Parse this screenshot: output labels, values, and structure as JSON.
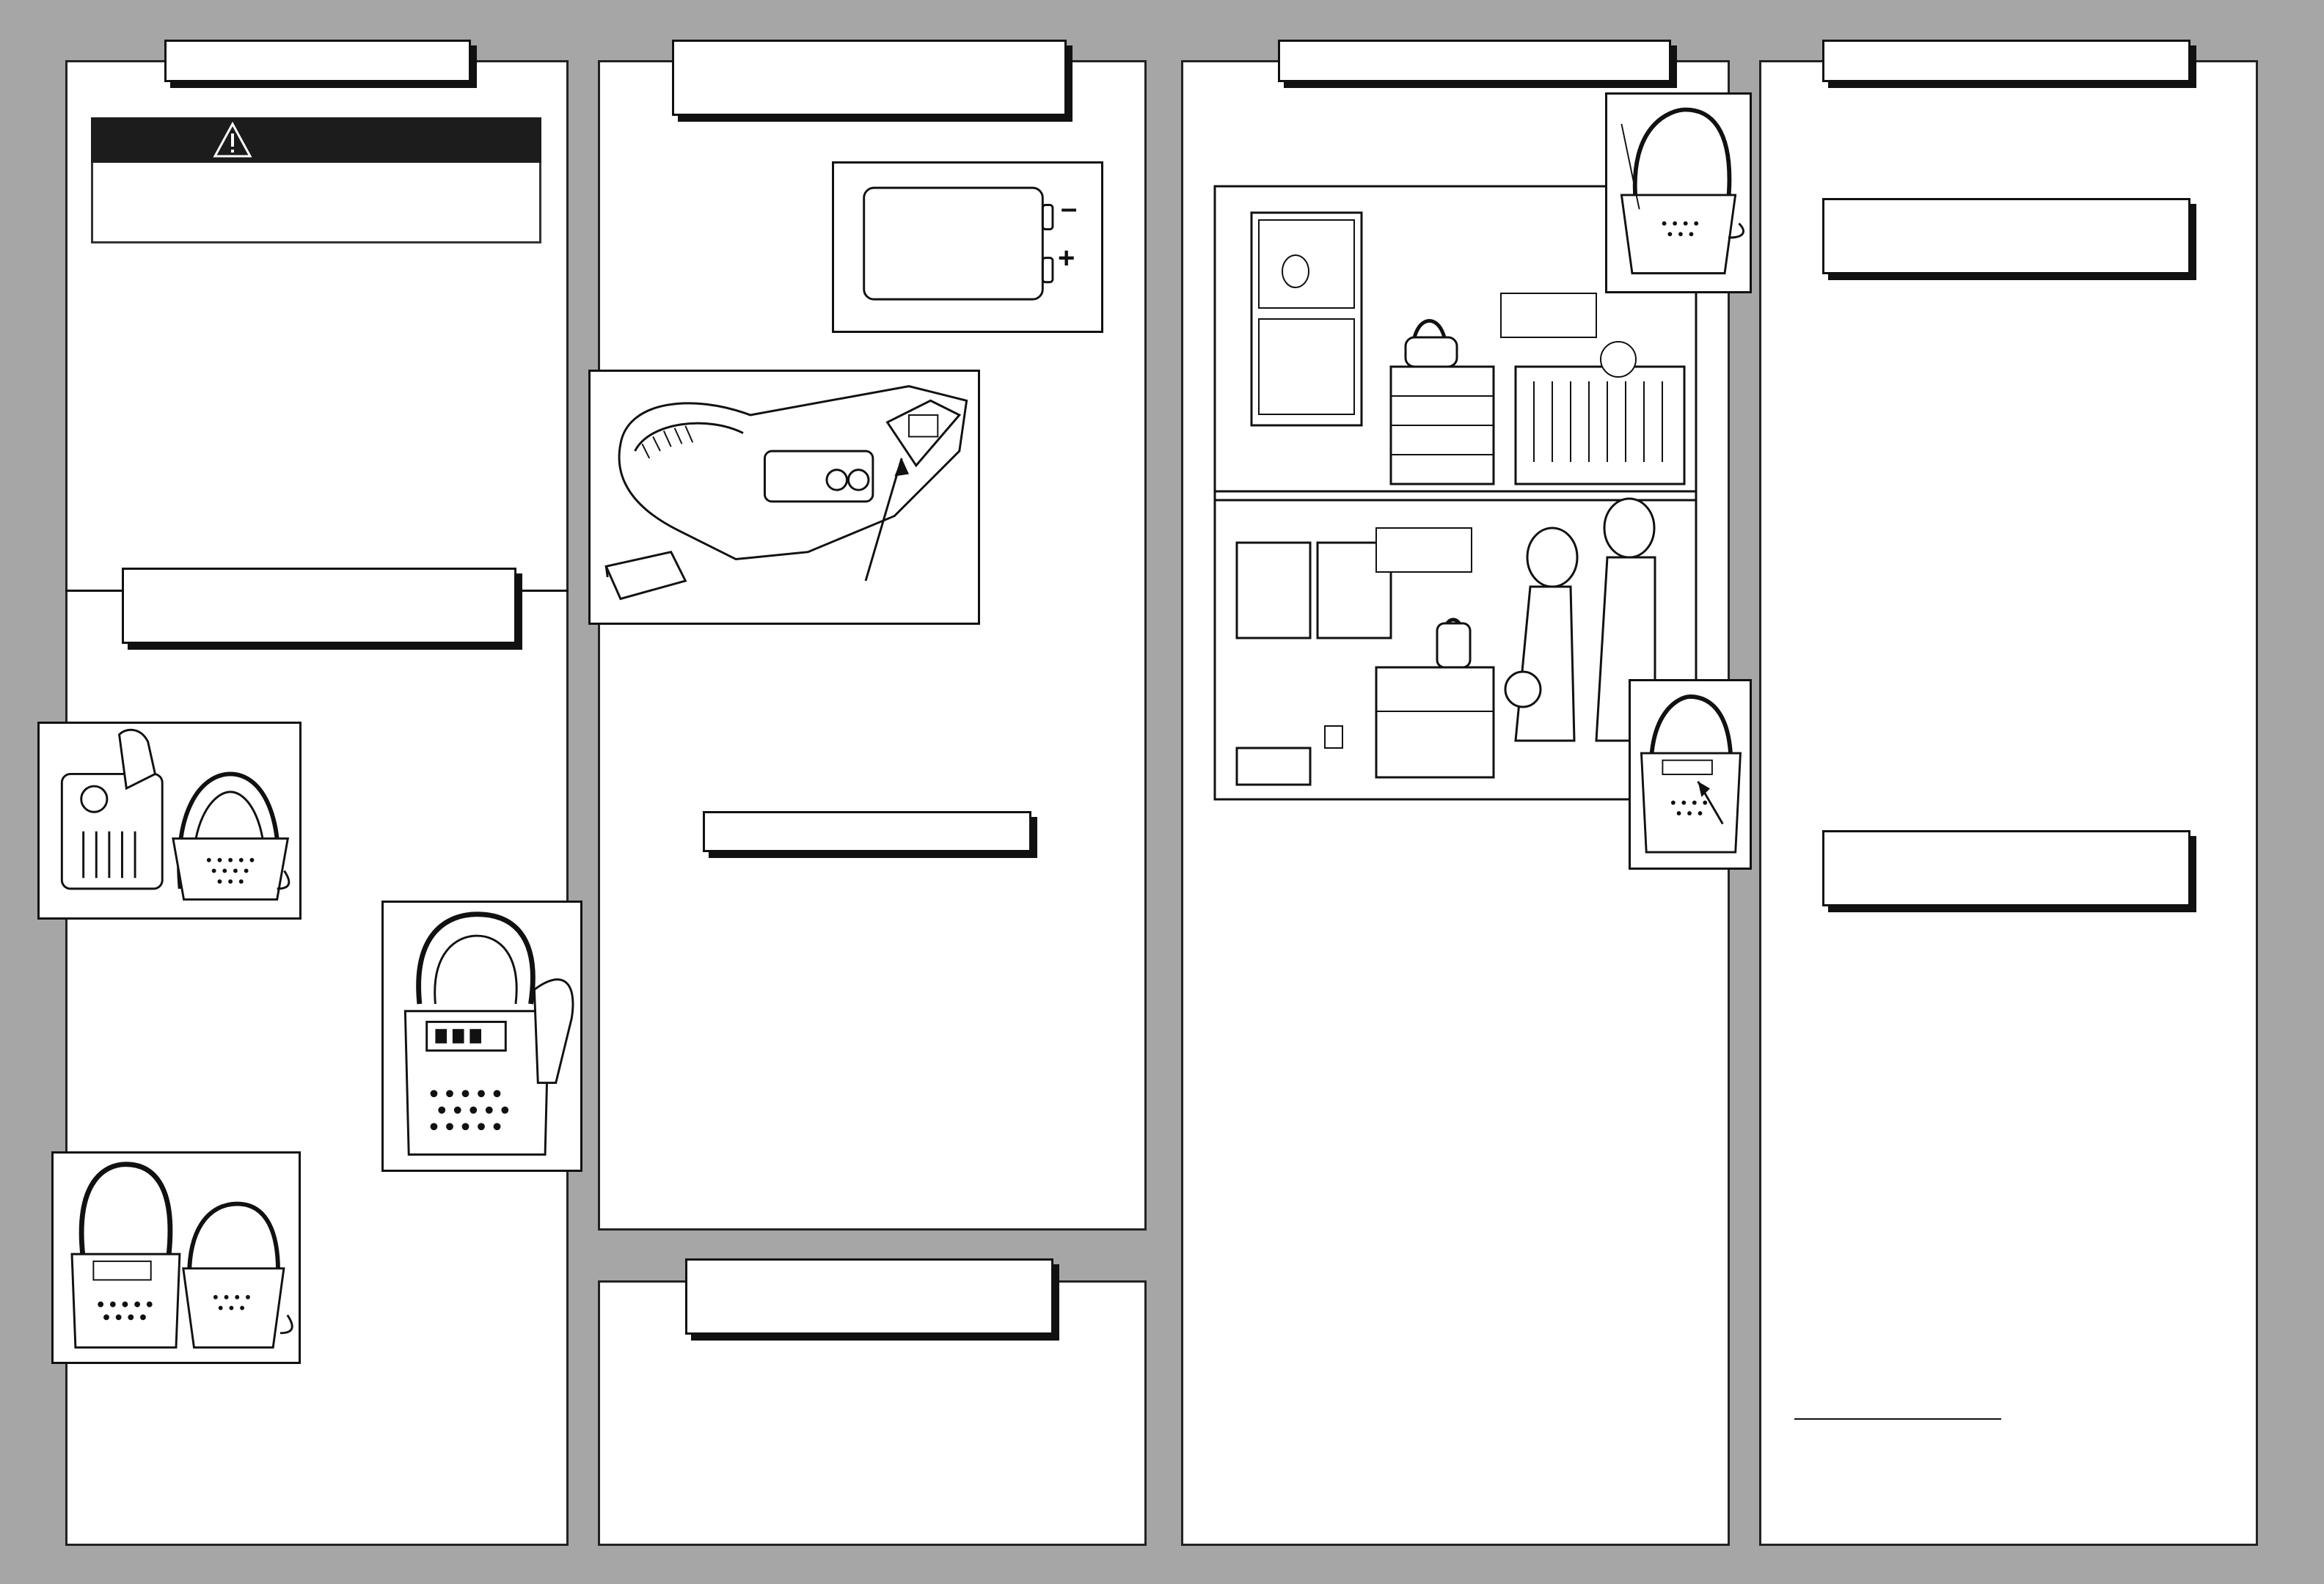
{
  "colors": {
    "page_background": "#a6a6a6",
    "panel_background": "#ffffff",
    "ink": "#111111",
    "warning_bar": "#1c1c1c"
  },
  "battery_figure": {
    "minus_label": "–",
    "plus_label": "+"
  },
  "icons": {
    "warning": "warning-triangle-icon"
  }
}
